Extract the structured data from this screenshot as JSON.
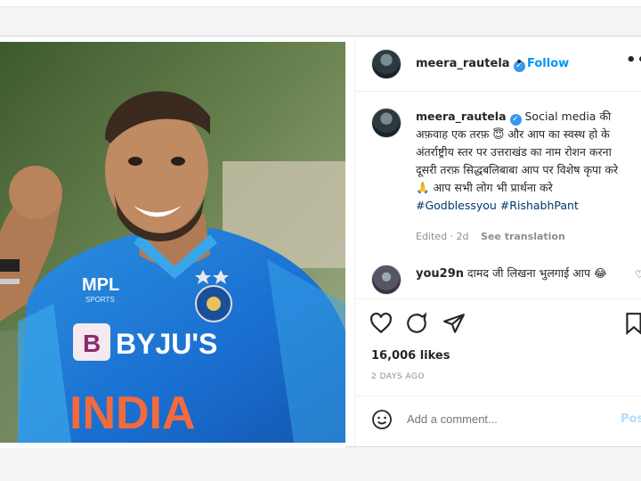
{
  "post": {
    "author": "meera_rautela",
    "follow_label": "Follow",
    "dot": "•",
    "more_label": "•••",
    "caption": {
      "author": "meera_rautela",
      "text_line1": "Social media की अफ़वाह एक तरफ़ 😇 और आप का स्वस्थ हो के अंतर्राष्ट्रीय स्तर पर उत्तराखंड का नाम रोशन करना दूसरी तरफ़",
      "text_line2": "सिद्धबलिबाबा आप पर विशेष कृपा करे 🙏 आप सभी लोग भी प्रार्थना करे",
      "hashtags": "#Godblessyou #RishabhPant",
      "edited": "Edited · 2d",
      "see_translation": "See translation"
    },
    "comment": {
      "author": "you29n",
      "text": "दामद जी लिखना भुलगाई आप 😂"
    },
    "likes": "16,006 likes",
    "time_ago": "2 DAYS AGO",
    "add_comment_placeholder": "Add a comment...",
    "post_label": "Post",
    "photo": {
      "jersey_brand": "MPL",
      "jersey_sub": "SPORTS",
      "sponsor": "BYJU'S",
      "sponsor_logo": "B",
      "country": "INDIA"
    }
  },
  "icons": {
    "verified": "verified-badge-icon",
    "heart": "heart-icon",
    "comment": "comment-icon",
    "share": "share-icon",
    "save": "bookmark-icon",
    "emoji": "emoji-icon"
  },
  "colors": {
    "link": "#0095f6",
    "hashtag": "#00376b",
    "jersey_blue": "#1f6fd1",
    "jersey_light": "#3aa6ea",
    "india_orange": "#f26a3d"
  }
}
